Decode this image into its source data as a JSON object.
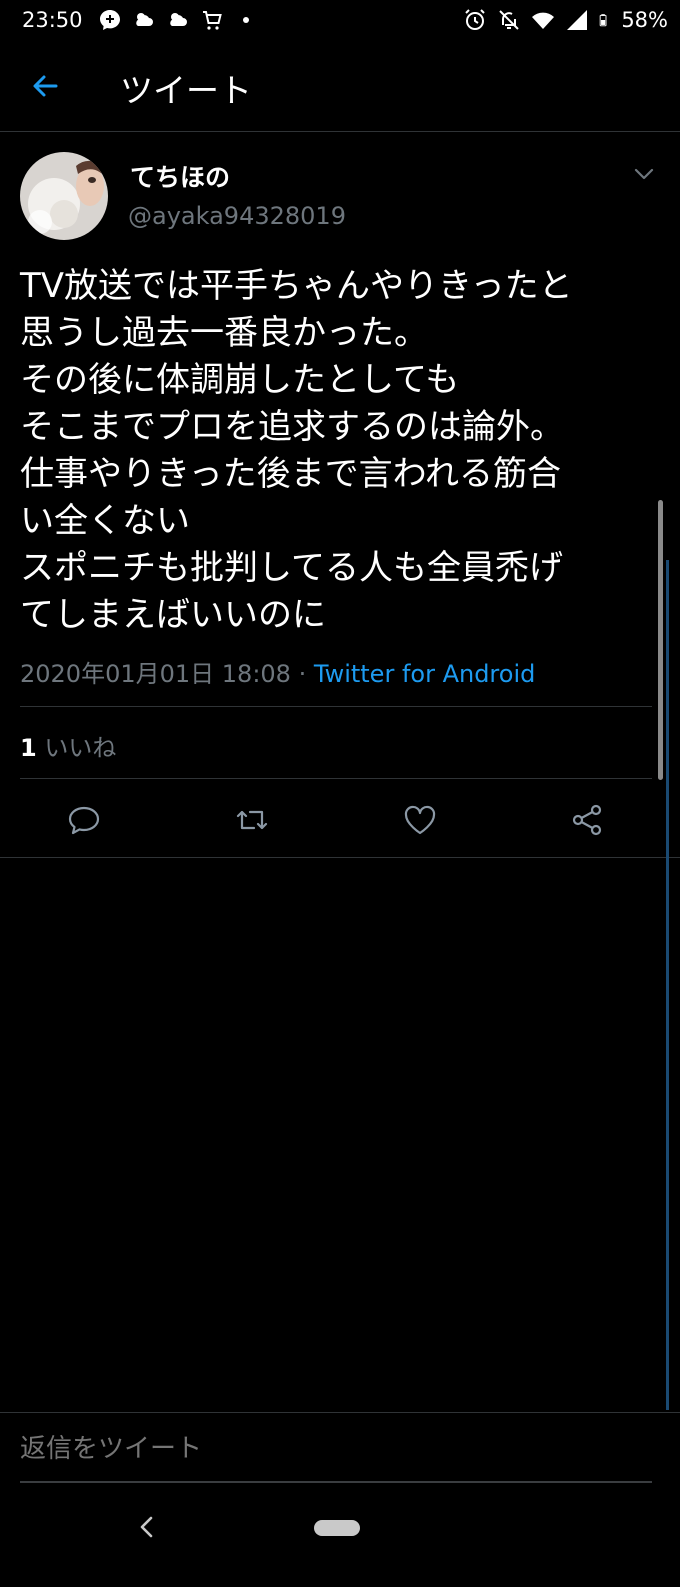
{
  "status_bar": {
    "time": "23:50",
    "battery": "58%",
    "left_icons": [
      "messenger-icon",
      "weather-icon",
      "weather-icon",
      "cart-icon",
      "dot-icon"
    ],
    "right_icons": [
      "alarm-icon",
      "bell-off-icon",
      "wifi-icon",
      "signal-icon",
      "battery-icon"
    ]
  },
  "header": {
    "title": "ツイート",
    "back_icon": "arrow-left-icon"
  },
  "tweet": {
    "display_name": "てちほの",
    "handle": "@ayaka94328019",
    "text": "TV放送では平手ちゃんやりきったと\n思うし過去一番良かった。\nその後に体調崩したとしても\nそこまでプロを追求するのは論外。\n仕事やりきった後まで言われる筋合\nい全くない\nスポニチも批判してる人も全員禿げ\nてしまえばいいのに",
    "date": "2020年01月01日 18:08",
    "separator": "·",
    "source": "Twitter for Android",
    "likes_count": "1",
    "likes_label": "いいね"
  },
  "actions": [
    "reply-icon",
    "retweet-icon",
    "like-icon",
    "share-icon"
  ],
  "reply": {
    "placeholder": "返信をツイート"
  },
  "colors": {
    "accent": "#1d9bf0",
    "secondary_text": "#6e767d",
    "divider": "#2f3336",
    "background": "#000000"
  }
}
